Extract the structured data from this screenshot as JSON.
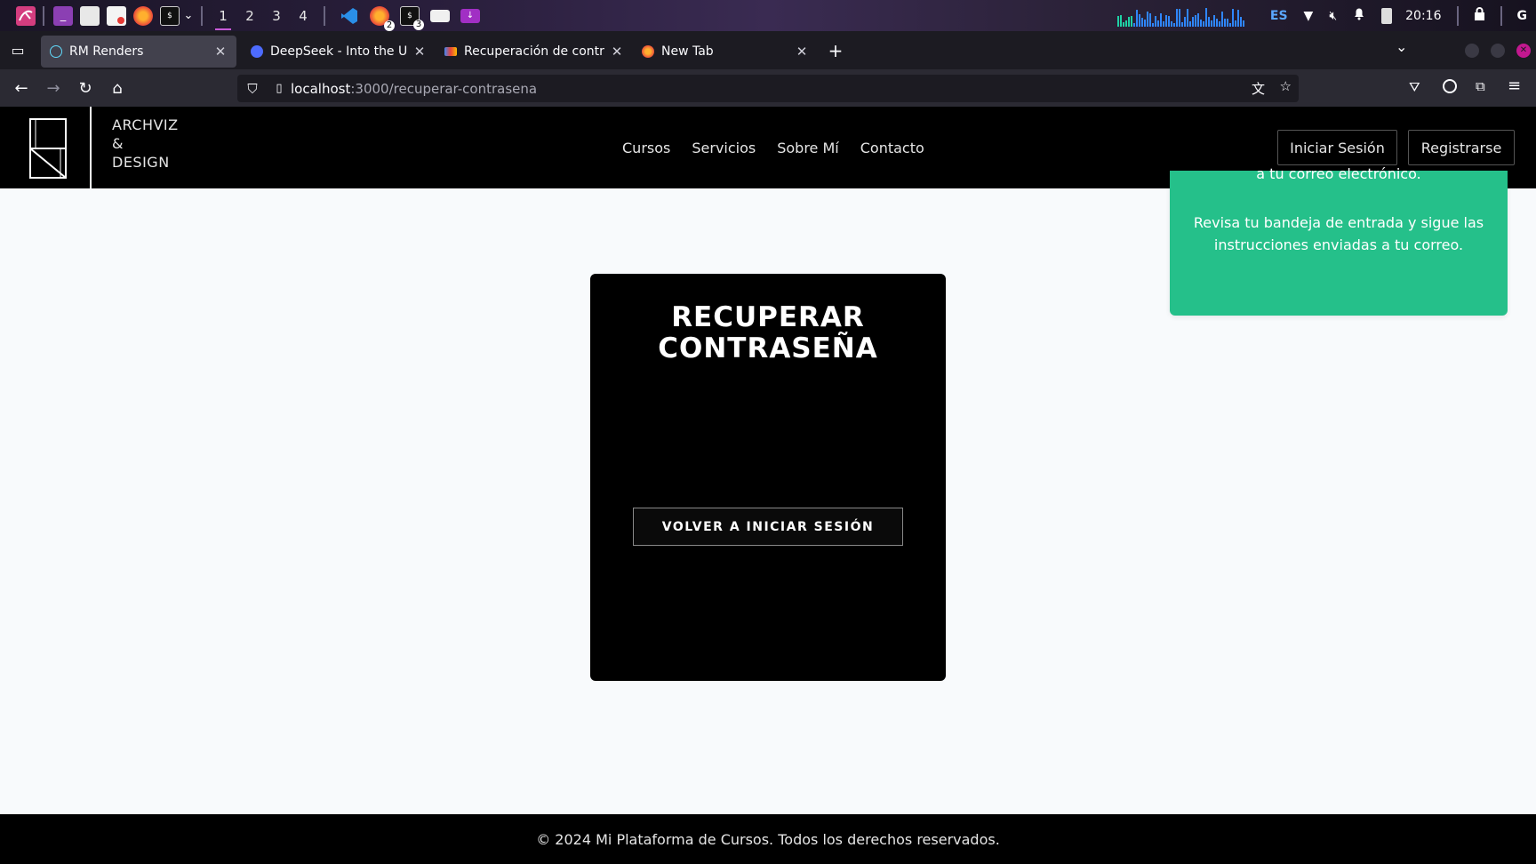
{
  "taskbar": {
    "workspaces": [
      "1",
      "2",
      "3",
      "4"
    ],
    "active_workspace": "1",
    "keyboard_layout": "ES",
    "clock": "20:16",
    "badge_firefox": "2",
    "badge_terminal": "3"
  },
  "browser": {
    "tabs": [
      {
        "title": "RM Renders",
        "favicon": "react-icon",
        "color": "#61dafb"
      },
      {
        "title": "DeepSeek - Into the Unknown",
        "favicon": "deepseek-icon",
        "color": "#4d6bfe"
      },
      {
        "title": "Recuperación de contraseña",
        "favicon": "gmail-icon",
        "color": "#ea4335"
      },
      {
        "title": "New Tab",
        "favicon": "firefox-icon",
        "color": "#ff7139"
      }
    ],
    "url_host": "localhost",
    "url_path": ":3000/recuperar-contrasena"
  },
  "site": {
    "logo_line1": "ARCHVIZ",
    "logo_line2": "&",
    "logo_line3": "DESIGN",
    "nav": [
      "Cursos",
      "Servicios",
      "Sobre Mí",
      "Contacto"
    ],
    "login_label": "Iniciar Sesión",
    "register_label": "Registrarse"
  },
  "card": {
    "title_line1": "RECUPERAR",
    "title_line2": "CONTRASEÑA",
    "back_button": "VOLVER A INICIAR SESIÓN"
  },
  "toast": {
    "line1": "a tu correo electrónico.",
    "line2": "Revisa tu bandeja de entrada y sigue las instrucciones enviadas a tu correo.",
    "color": "#25c08a"
  },
  "footer": {
    "text": "© 2024 Mi Plataforma de Cursos. Todos los derechos reservados."
  }
}
